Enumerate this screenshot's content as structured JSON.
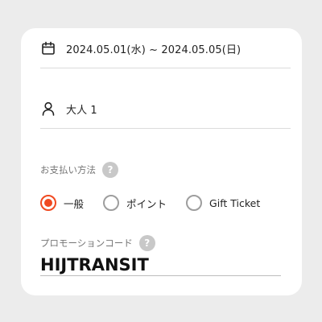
{
  "booking": {
    "date_range": "2024.05.01(水) ~ 2024.05.05(日)",
    "guests": "大人 1",
    "date_icon": "calendar-icon",
    "guest_icon": "person-icon"
  },
  "payment": {
    "label": "お支払い方法",
    "help": "?",
    "options": [
      {
        "label": "一般",
        "selected": true
      },
      {
        "label": "ポイント",
        "selected": false
      },
      {
        "label": "Gift Ticket",
        "selected": false
      }
    ]
  },
  "promo": {
    "label": "プロモーションコード",
    "help": "?",
    "value": "HIJTRANSIT"
  },
  "colors": {
    "accent": "#f04a21",
    "background": "#ececec",
    "card": "#ffffff"
  }
}
